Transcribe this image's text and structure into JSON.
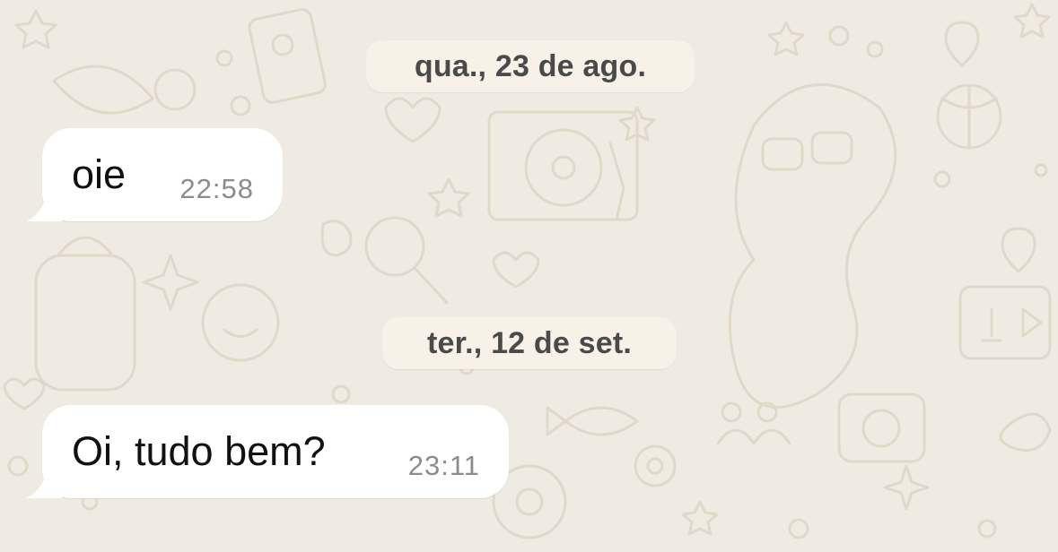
{
  "chat": {
    "date_separators": [
      {
        "label": "qua., 23 de ago."
      },
      {
        "label": "ter., 12 de set."
      }
    ],
    "messages": [
      {
        "direction": "incoming",
        "text": "oie",
        "time": "22:58"
      },
      {
        "direction": "incoming",
        "text": "Oi, tudo bem?",
        "time": "23:11"
      }
    ]
  },
  "colors": {
    "background": "#efeae2",
    "doodle": "#e2d8ca",
    "bubble_incoming": "#ffffff",
    "date_pill": "#f8f1e8",
    "time_text": "#8c8c8c"
  }
}
